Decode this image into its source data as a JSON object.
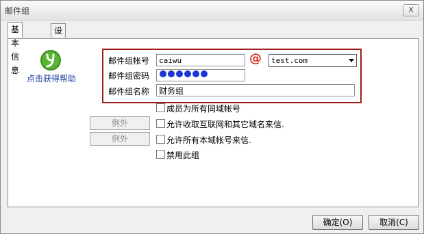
{
  "window": {
    "title": "邮件组",
    "close_label": "X"
  },
  "tabs": [
    {
      "label": "基本信息",
      "active": true
    },
    {
      "label": "设定成员",
      "active": false
    }
  ],
  "help": {
    "label": "点击获得帮助",
    "icon": "help-leaf-icon"
  },
  "form": {
    "account_label": "邮件组帐号",
    "account_value": "caiwu",
    "at_symbol": "@",
    "domain_value": "test.com",
    "password_label": "邮件组密码",
    "password_dots": 6,
    "name_label": "邮件组名称",
    "name_value": "财务组"
  },
  "options": [
    {
      "label": "成员为所有同域帐号",
      "checked": false
    },
    {
      "label": "允许收取互联网和其它域名来信.",
      "checked": false
    },
    {
      "label": "允许所有本域帐号来信.",
      "checked": false
    },
    {
      "label": "禁用此组",
      "checked": false
    }
  ],
  "exceptions": [
    {
      "label": "例外",
      "enabled": false
    },
    {
      "label": "例外",
      "enabled": false
    }
  ],
  "buttons": {
    "ok": "确定(O)",
    "cancel": "取消(C)"
  }
}
